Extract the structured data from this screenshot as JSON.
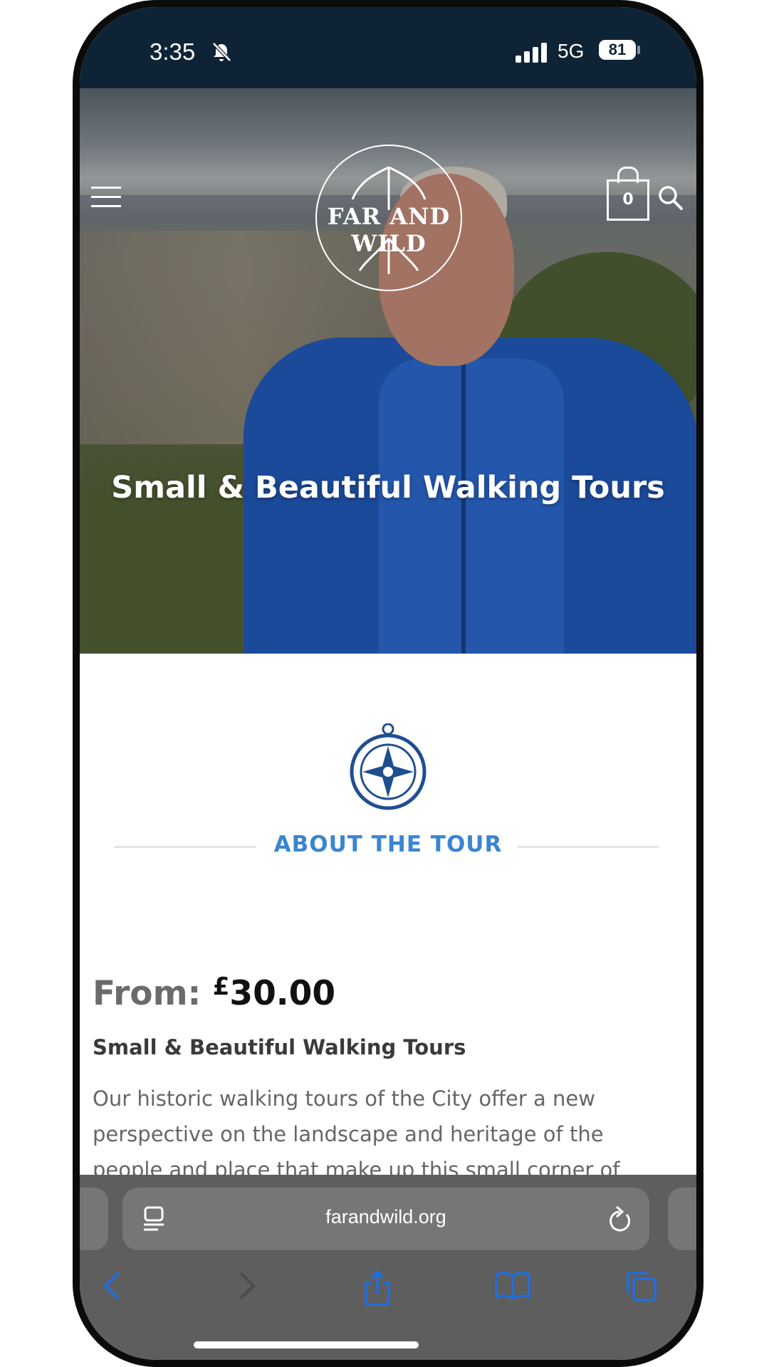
{
  "status_bar": {
    "time": "3:35",
    "network": "5G",
    "battery": "81"
  },
  "header": {
    "logo_text": "FAR AND WILD",
    "cart_count": "0"
  },
  "hero": {
    "title": "Small & Beautiful Walking Tours"
  },
  "about": {
    "title": "ABOUT THE TOUR"
  },
  "product": {
    "price_label": "From:",
    "currency": "£",
    "price": "30.00",
    "name": "Small & Beautiful Walking Tours",
    "description": "Our historic walking tours of the City offer a new perspective on the landscape and heritage of the people and place that make up this small corner of"
  },
  "browser": {
    "url": "farandwild.org"
  },
  "colors": {
    "status_bar_bg": "#0e2436",
    "accent_blue": "#3b85d1",
    "toolbar_icon_blue": "#1f6fe0",
    "safari_bar_bg": "#5e5e5e"
  }
}
